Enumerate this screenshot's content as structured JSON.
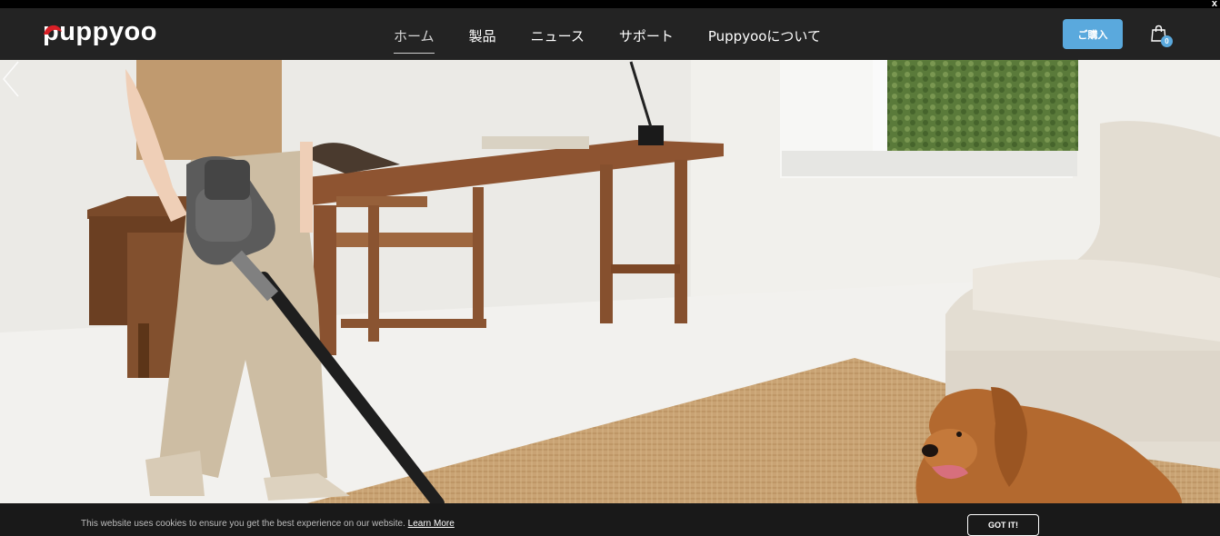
{
  "close_label": "x",
  "header": {
    "logo_text": "puppyoo",
    "nav": [
      {
        "label": "ホーム",
        "active": true
      },
      {
        "label": "製品"
      },
      {
        "label": "ニュース"
      },
      {
        "label": "サポート"
      },
      {
        "label": "Puppyooについて"
      }
    ],
    "buy_label": "ご購入",
    "cart_count": "0"
  },
  "cookie": {
    "message": "This website uses cookies to ensure you get the best experience on our website.",
    "learn_more": "Learn More",
    "accept_label": "GOT IT!"
  }
}
